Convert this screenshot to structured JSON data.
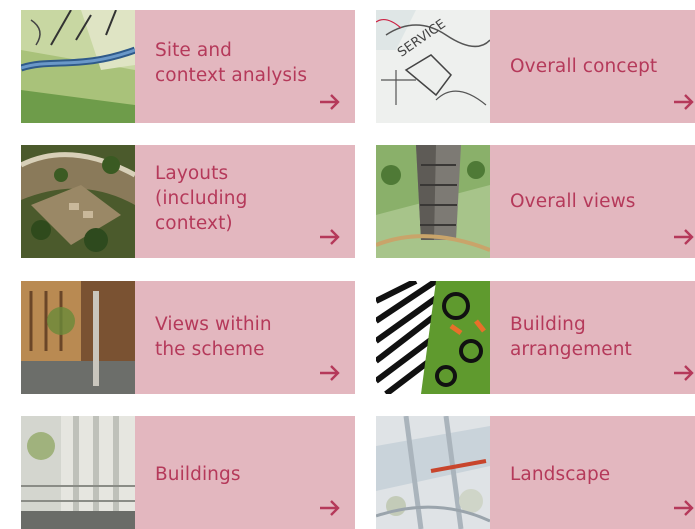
{
  "colors": {
    "tile_background": "#e3b7bf",
    "text": "#b5395a",
    "arrow": "#b5395a"
  },
  "tiles": [
    {
      "label_lines": [
        "Site and",
        "context analysis"
      ],
      "thumbnail": "site-map-thumbnail",
      "icon": "arrow-right-icon"
    },
    {
      "label_lines": [
        "Overall concept"
      ],
      "thumbnail": "concept-sketch-thumbnail",
      "icon": "arrow-right-icon"
    },
    {
      "label_lines": [
        "Layouts",
        "(including",
        "context)"
      ],
      "thumbnail": "aerial-layout-thumbnail",
      "icon": "arrow-right-icon"
    },
    {
      "label_lines": [
        "Overall views"
      ],
      "thumbnail": "tower-view-thumbnail",
      "icon": "arrow-right-icon"
    },
    {
      "label_lines": [
        "Views within",
        "the scheme"
      ],
      "thumbnail": "street-view-thumbnail",
      "icon": "arrow-right-icon"
    },
    {
      "label_lines": [
        "Building",
        "arrangement"
      ],
      "thumbnail": "building-pattern-thumbnail",
      "icon": "arrow-right-icon"
    },
    {
      "label_lines": [
        "Buildings"
      ],
      "thumbnail": "facade-thumbnail",
      "icon": "arrow-right-icon"
    },
    {
      "label_lines": [
        "Landscape"
      ],
      "thumbnail": "landscape-plan-thumbnail",
      "icon": "arrow-right-icon"
    }
  ]
}
